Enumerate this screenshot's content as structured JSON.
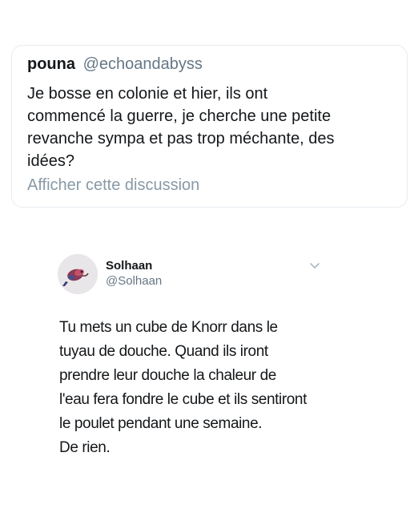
{
  "quoted_tweet": {
    "display_name": "pouna",
    "handle": "@echoandabyss",
    "text": "Je bosse en colonie et hier, ils ont\ncommencé la guerre, je cherche une petite\nrevanche sympa et pas trop méchante, des\nidées?",
    "show_thread_label": "Afficher cette discussion"
  },
  "reply_tweet": {
    "display_name": "Solhaan",
    "handle": "@Solhaan",
    "avatar_icon": "avatar-image",
    "menu_icon": "chevron-down-icon",
    "text_lines": [
      "Tu mets un cube de Knorr dans le",
      "tuyau de douche. Quand ils iront",
      "prendre leur douche la chaleur de",
      "l'eau fera fondre le cube et ils sentiront",
      "le poulet pendant une semaine.",
      "De rien."
    ]
  },
  "colors": {
    "text_primary": "#14171a",
    "text_secondary": "#657786",
    "link_muted": "#8899a6",
    "card_border": "#e6ecf0"
  }
}
